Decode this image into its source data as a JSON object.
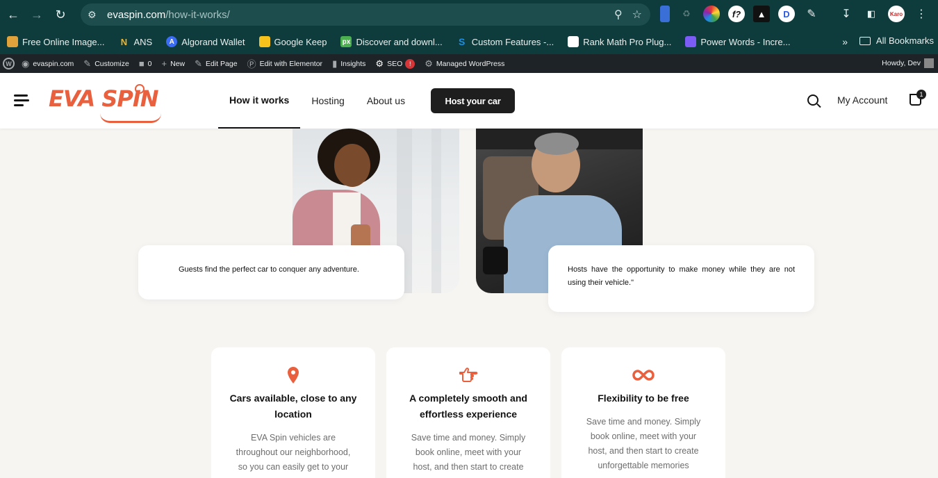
{
  "browser": {
    "url_domain": "evaspin.com",
    "url_path": "/how-it-works/"
  },
  "bookmarks": {
    "items": [
      {
        "label": "Free Online Image...",
        "color": "#e0a33c"
      },
      {
        "label": "ANS",
        "color": "#f0b429"
      },
      {
        "label": "Algorand Wallet",
        "color": "#3b6cf5"
      },
      {
        "label": "Google Keep",
        "color": "#f7c21b"
      },
      {
        "label": "Discover and downl...",
        "color": "#4caf50"
      },
      {
        "label": "Custom Features -...",
        "color": "#1a8fe3"
      },
      {
        "label": "Rank Math Pro Plug...",
        "color": "#ffffff"
      },
      {
        "label": "Power Words - Incre...",
        "color": "#7b5cf5"
      }
    ],
    "all_label": "All Bookmarks"
  },
  "wpbar": {
    "site": "evaspin.com",
    "customize": "Customize",
    "comments": "0",
    "new": "New",
    "edit_page": "Edit Page",
    "edit_elementor": "Edit with Elementor",
    "insights": "Insights",
    "seo": "SEO",
    "seo_badge": "!",
    "managed": "Managed WordPress",
    "howdy": "Howdy, Dev"
  },
  "header": {
    "logo": "EVA SPIN",
    "menu": [
      "How it works",
      "Hosting",
      "About us"
    ],
    "cta": "Host your car",
    "account": "My Account",
    "cart_count": "1"
  },
  "hero": {
    "guest_caption": "Guests find the perfect car to conquer any adventure.",
    "host_caption": "Hosts have the opportunity to make money while they are not using their vehicle.\""
  },
  "features": [
    {
      "icon": "location-pin-icon",
      "title": "Cars available, close to any location",
      "text": "EVA Spin vehicles are throughout our neighborhood, so you can easily get to your"
    },
    {
      "icon": "pointing-hand-icon",
      "title": "A completely smooth and effortless experience",
      "text": "Save time and money. Simply book online, meet with your host, and then start to create"
    },
    {
      "icon": "infinity-icon",
      "title": "Flexibility to be free",
      "text": "Save time and money. Simply book online, meet with your host, and then start to create unforgettable memories"
    }
  ],
  "colors": {
    "brand": "#e9603e",
    "browser_bg": "#0e3b3b",
    "wpbar_bg": "#1d2327",
    "page_bg": "#f7f5f2"
  }
}
